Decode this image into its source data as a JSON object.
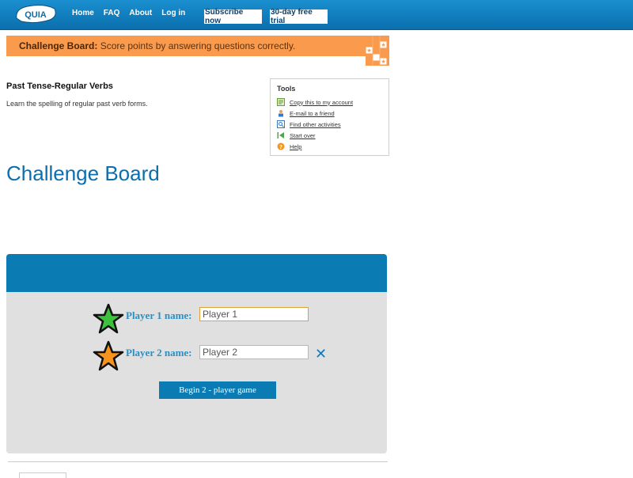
{
  "header": {
    "logo_text": "QUIA",
    "nav": [
      "Home",
      "FAQ",
      "About",
      "Log in"
    ],
    "subscribe_label": "Subscribe now",
    "trial_label": "30-day free trial"
  },
  "banner": {
    "title": "Challenge Board:",
    "text": "Score points by answering questions correctly."
  },
  "activity": {
    "title": "Past Tense-Regular Verbs",
    "description": "Learn the spelling of regular past verb forms."
  },
  "tools": {
    "title": "Tools",
    "items": [
      {
        "label": "Copy this to my account",
        "icon": "copy-icon"
      },
      {
        "label": "E-mail to a friend",
        "icon": "email-icon"
      },
      {
        "label": "Find other activities",
        "icon": "find-icon"
      },
      {
        "label": "Start over",
        "icon": "start-over-icon"
      },
      {
        "label": "Help",
        "icon": "help-icon"
      }
    ]
  },
  "game": {
    "heading": "Challenge Board",
    "player1_label": "Player 1 name:",
    "player1_value": "Player 1",
    "player2_label": "Player 2 name:",
    "player2_value": "Player 2",
    "remove_symbol": "✕",
    "begin_label": "Begin 2 - player game"
  },
  "colors": {
    "header_blue": "#0b6fae",
    "banner_orange": "#f99a4d",
    "panel_gray": "#e0e0e0",
    "star1": "#3ec23e",
    "star2": "#f7941d"
  }
}
